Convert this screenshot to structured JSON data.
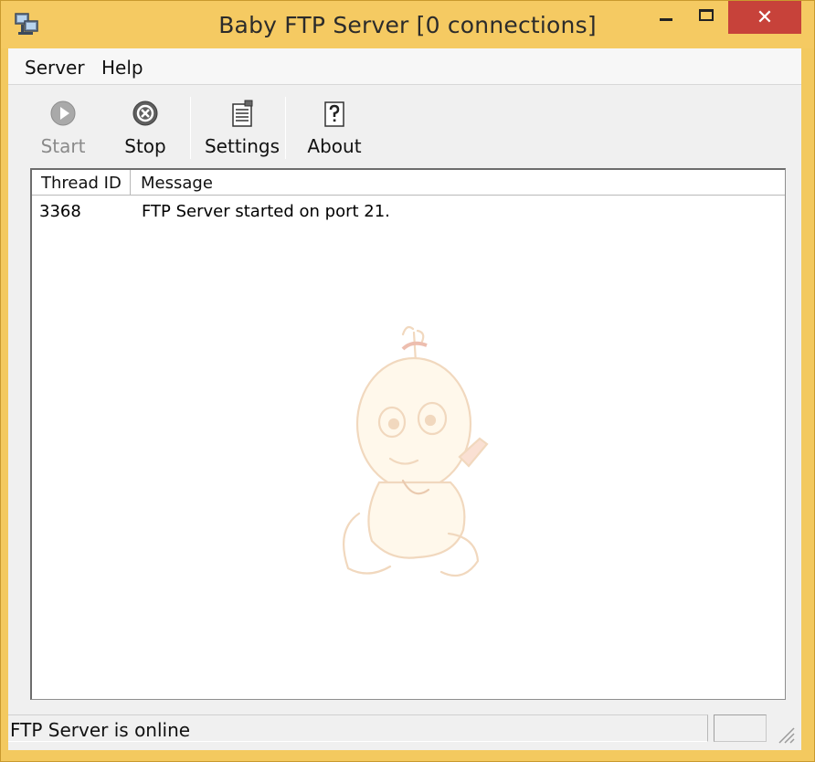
{
  "window": {
    "title": "Baby FTP Server [0 connections]",
    "close_glyph": "✕"
  },
  "menu": {
    "items": [
      "Server",
      "Help"
    ]
  },
  "toolbar": {
    "buttons": [
      {
        "label": "Start",
        "icon": "play-circle-icon",
        "enabled": false
      },
      {
        "label": "Stop",
        "icon": "stop-circle-icon",
        "enabled": true
      },
      {
        "label": "Settings",
        "icon": "settings-document-icon",
        "enabled": true
      },
      {
        "label": "About",
        "icon": "help-question-icon",
        "enabled": true
      }
    ]
  },
  "log": {
    "columns": [
      "Thread ID",
      "Message"
    ],
    "rows": [
      {
        "thread_id": "3368",
        "message": "FTP Server started on port 21."
      }
    ]
  },
  "status": {
    "text": "FTP Server is online"
  },
  "colors": {
    "frame": "#f3c95f",
    "close_button": "#c7423a"
  }
}
